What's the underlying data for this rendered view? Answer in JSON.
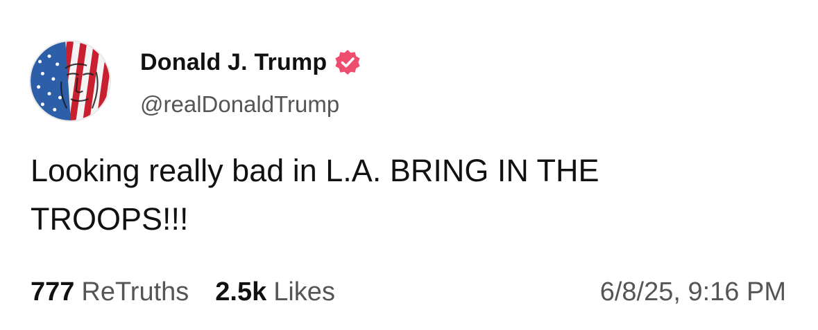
{
  "author": {
    "display_name": "Donald J. Trump",
    "handle": "@realDonaldTrump",
    "avatar": "flag-portrait-avatar",
    "verified_icon": "verified-badge-icon"
  },
  "post": {
    "lines": [
      "Looking really bad in L.A. BRING IN THE",
      "TROOPS!!!"
    ]
  },
  "stats": {
    "retruths_count": "777",
    "retruths_label": "ReTruths",
    "likes_count": "2.5k",
    "likes_label": "Likes"
  },
  "timestamp": "6/8/25, 9:16 PM",
  "colors": {
    "verified_badge": "#ef4d6e",
    "secondary_text": "#555555",
    "primary_text": "#111111"
  }
}
